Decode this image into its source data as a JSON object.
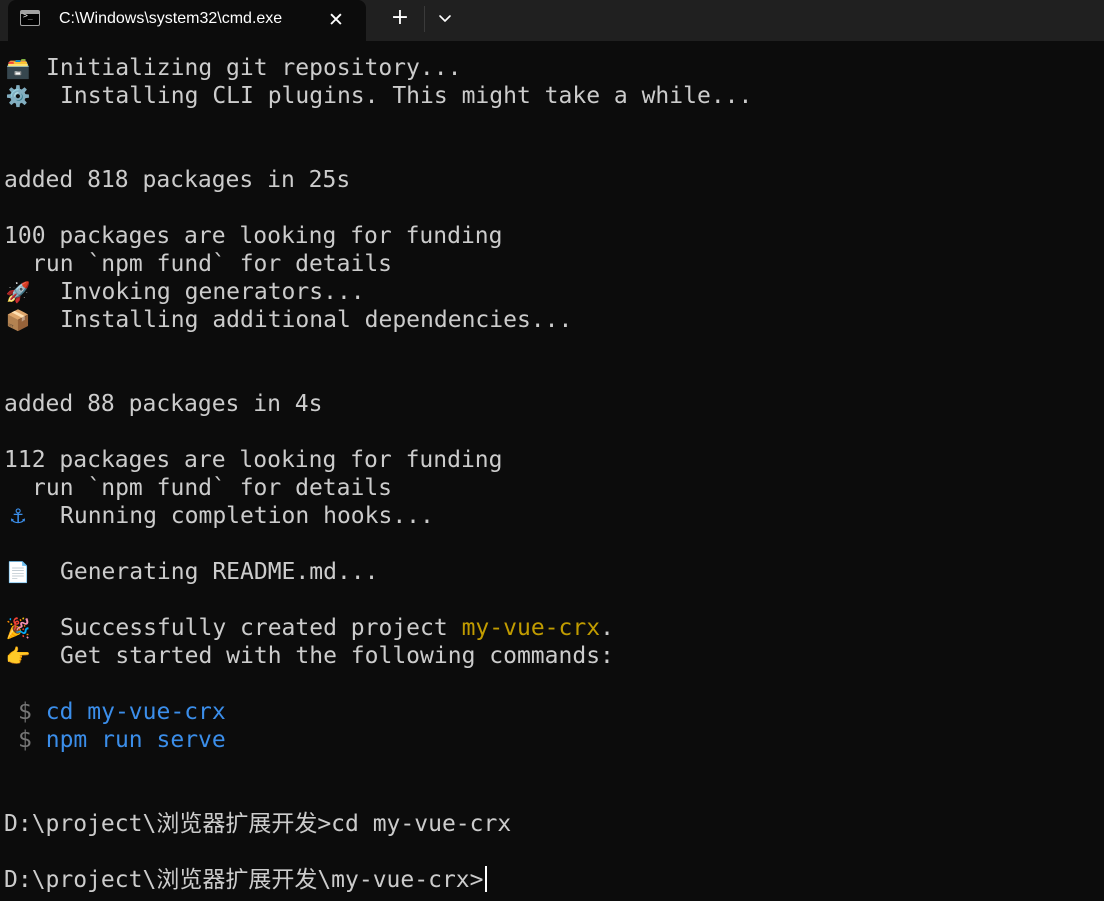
{
  "window": {
    "tab_title": "C:\\Windows\\system32\\cmd.exe",
    "icons": {
      "tab": "terminal-icon",
      "close": "close-icon",
      "new_tab": "plus-icon",
      "dropdown": "chevron-down-icon"
    }
  },
  "colors": {
    "background": "#0c0c0c",
    "titlebar": "#202020",
    "text": "#cccccc",
    "project_name": "#c19c00",
    "command": "#3b8eea"
  },
  "lines": {
    "git_emoji": "🗃️",
    "git": "Initializing git repository...",
    "plugins_emoji": "⚙️",
    "plugins": "Installing CLI plugins. This might take a while...",
    "added_1": "added 818 packages in 25s",
    "funding_1": "100 packages are looking for funding",
    "fund_details_1": "run `npm fund` for details",
    "generators_emoji": "🚀",
    "generators": "Invoking generators...",
    "dependencies_emoji": "📦",
    "dependencies": "Installing additional dependencies...",
    "added_2": "added 88 packages in 4s",
    "funding_2": "112 packages are looking for funding",
    "fund_details_2": "run `npm fund` for details",
    "hooks_emoji": "⚓",
    "hooks": "Running completion hooks...",
    "readme_emoji": "📄",
    "readme": "Generating README.md...",
    "success_emoji": "🎉",
    "success_prefix": "Successfully created project ",
    "project_name": "my-vue-crx",
    "success_suffix": ".",
    "get_started_emoji": "👉",
    "get_started": "Get started with the following commands:",
    "dollar": "$",
    "cmd_cd": "cd my-vue-crx",
    "cmd_serve": "npm run serve",
    "prompt_1": "D:\\project\\浏览器扩展开发>cd my-vue-crx",
    "prompt_2": "D:\\project\\浏览器扩展开发\\my-vue-crx>"
  }
}
